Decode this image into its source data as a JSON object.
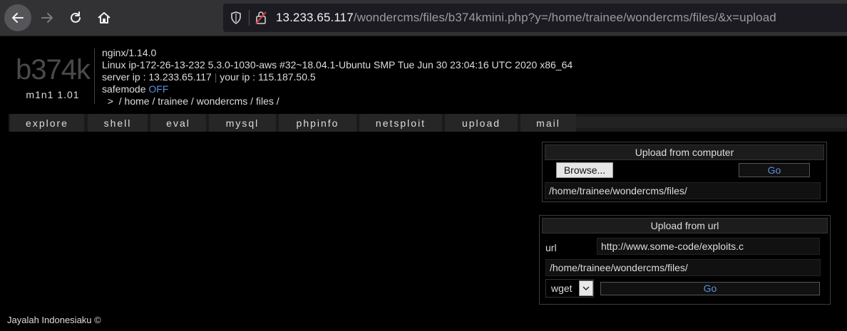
{
  "browser": {
    "url_host": "13.233.65.117",
    "url_path": "/wondercms/files/b374kmini.php?y=/home/trainee/wondercms/files/&x=upload"
  },
  "header": {
    "logo": "b374k",
    "version": "m1n1 1.01",
    "server_software": "nginx/1.14.0",
    "uname": "Linux ip-172-26-13-232 5.3.0-1030-aws #32~18.04.1-Ubuntu SMP Tue Jun 30 23:04:16 UTC 2020 x86_64",
    "server_ip_label": "server ip : 13.233.65.117",
    "separator": "|",
    "your_ip_label": "your ip : 115.187.50.5",
    "safemode_label": "safemode",
    "safemode_value": "OFF",
    "path_prefix": ">",
    "path": [
      " / home",
      " / trainee",
      " / wondercms",
      " / files",
      " /"
    ]
  },
  "menu": [
    {
      "label": "explore"
    },
    {
      "label": "shell"
    },
    {
      "label": "eval"
    },
    {
      "label": "mysql"
    },
    {
      "label": "phpinfo"
    },
    {
      "label": "netsploit"
    },
    {
      "label": "upload"
    },
    {
      "label": "mail"
    }
  ],
  "upload_computer": {
    "title": "Upload from computer",
    "browse_label": "Browse...",
    "go_label": "Go",
    "path_value": "/home/trainee/wondercms/files/"
  },
  "upload_url": {
    "title": "Upload from url",
    "url_label": "url",
    "url_value": "http://www.some-code/exploits.c",
    "path_value": "/home/trainee/wondercms/files/",
    "method_value": "wget",
    "go_label": "Go"
  },
  "footer": {
    "text": "Jayalah Indonesiaku ©"
  },
  "colors": {
    "accent_link": "#5b8fd6",
    "background": "#000000",
    "toolbar": "#323234"
  }
}
